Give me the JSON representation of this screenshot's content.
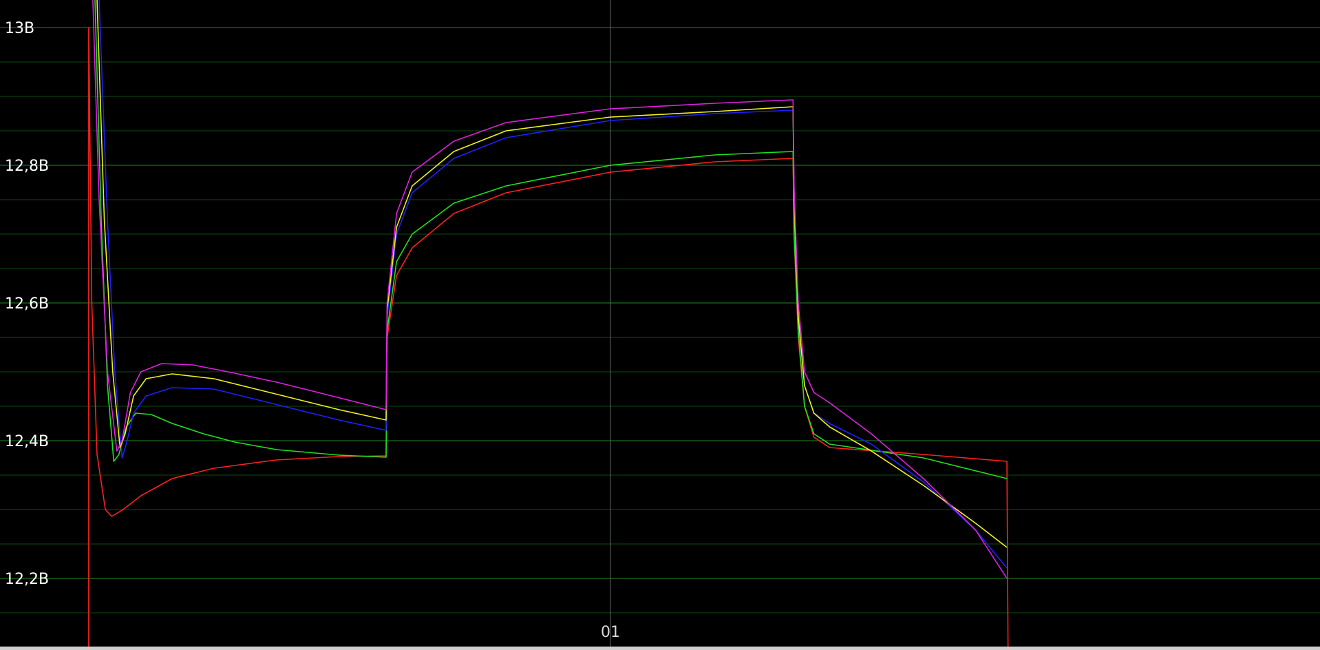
{
  "chart_data": {
    "type": "line",
    "background": "#000000",
    "grid": true,
    "grid_color": "#1f8a1f",
    "ylim": [
      12.1,
      13.04
    ],
    "y_major_ticks": [
      {
        "value": 13.0,
        "label": "13В"
      },
      {
        "value": 12.8,
        "label": "12,8В"
      },
      {
        "value": 12.6,
        "label": "12,6В"
      },
      {
        "value": 12.4,
        "label": "12,4В"
      },
      {
        "value": 12.2,
        "label": "12,2В"
      }
    ],
    "y_minor_ticks": [
      12.95,
      12.9,
      12.85,
      12.75,
      12.7,
      12.65,
      12.55,
      12.5,
      12.45,
      12.35,
      12.3,
      12.25,
      12.15
    ],
    "x_markers": [
      {
        "x": 50,
        "label": "01"
      }
    ],
    "x_range": [
      -8.5,
      118
    ],
    "series": [
      {
        "color": "#ff2020",
        "points": [
          [
            0,
            12.1
          ],
          [
            0,
            13.0
          ],
          [
            0.3,
            12.6
          ],
          [
            0.8,
            12.38
          ],
          [
            1.6,
            12.3
          ],
          [
            2.2,
            12.29
          ],
          [
            3.3,
            12.3
          ],
          [
            5,
            12.32
          ],
          [
            8,
            12.345
          ],
          [
            12,
            12.36
          ],
          [
            18,
            12.372
          ],
          [
            24,
            12.377
          ],
          [
            28.5,
            12.378
          ],
          [
            28.6,
            12.55
          ],
          [
            29.5,
            12.64
          ],
          [
            31,
            12.68
          ],
          [
            35,
            12.73
          ],
          [
            40,
            12.76
          ],
          [
            50,
            12.79
          ],
          [
            60,
            12.805
          ],
          [
            67.5,
            12.81
          ],
          [
            67.6,
            12.7
          ],
          [
            68,
            12.55
          ],
          [
            68.6,
            12.45
          ],
          [
            69.5,
            12.405
          ],
          [
            71,
            12.39
          ],
          [
            80,
            12.38
          ],
          [
            88,
            12.37
          ],
          [
            88.1,
            12.1
          ]
        ]
      },
      {
        "color": "#20e020",
        "points": [
          [
            0.6,
            13.04
          ],
          [
            1.2,
            12.72
          ],
          [
            1.8,
            12.48
          ],
          [
            2.4,
            12.37
          ],
          [
            2.9,
            12.38
          ],
          [
            3.6,
            12.42
          ],
          [
            4.5,
            12.44
          ],
          [
            6,
            12.438
          ],
          [
            8,
            12.425
          ],
          [
            11,
            12.41
          ],
          [
            14,
            12.398
          ],
          [
            18,
            12.387
          ],
          [
            24,
            12.379
          ],
          [
            28.5,
            12.376
          ],
          [
            28.6,
            12.56
          ],
          [
            29.5,
            12.66
          ],
          [
            31,
            12.7
          ],
          [
            35,
            12.745
          ],
          [
            40,
            12.77
          ],
          [
            50,
            12.8
          ],
          [
            60,
            12.815
          ],
          [
            67.5,
            12.82
          ],
          [
            67.6,
            12.7
          ],
          [
            68,
            12.56
          ],
          [
            68.6,
            12.45
          ],
          [
            69.5,
            12.41
          ],
          [
            71,
            12.395
          ],
          [
            80,
            12.375
          ],
          [
            88,
            12.345
          ]
        ]
      },
      {
        "color": "#2020ff",
        "points": [
          [
            1.0,
            13.04
          ],
          [
            1.8,
            12.72
          ],
          [
            2.5,
            12.5
          ],
          [
            3.2,
            12.375
          ],
          [
            3.6,
            12.395
          ],
          [
            4.3,
            12.44
          ],
          [
            5.5,
            12.465
          ],
          [
            8,
            12.477
          ],
          [
            12,
            12.475
          ],
          [
            16,
            12.46
          ],
          [
            20,
            12.445
          ],
          [
            24,
            12.43
          ],
          [
            28.5,
            12.415
          ],
          [
            28.6,
            12.58
          ],
          [
            29.5,
            12.7
          ],
          [
            31,
            12.76
          ],
          [
            35,
            12.81
          ],
          [
            40,
            12.84
          ],
          [
            50,
            12.865
          ],
          [
            60,
            12.875
          ],
          [
            67.5,
            12.88
          ],
          [
            67.6,
            12.75
          ],
          [
            68,
            12.58
          ],
          [
            68.6,
            12.48
          ],
          [
            69.5,
            12.44
          ],
          [
            71,
            12.425
          ],
          [
            75,
            12.395
          ],
          [
            80,
            12.34
          ],
          [
            85,
            12.27
          ],
          [
            88,
            12.215
          ]
        ]
      },
      {
        "color": "#f0f020",
        "points": [
          [
            0.8,
            13.04
          ],
          [
            1.5,
            12.72
          ],
          [
            2.3,
            12.5
          ],
          [
            3.0,
            12.39
          ],
          [
            3.5,
            12.41
          ],
          [
            4.3,
            12.465
          ],
          [
            5.5,
            12.49
          ],
          [
            8,
            12.497
          ],
          [
            12,
            12.49
          ],
          [
            16,
            12.475
          ],
          [
            20,
            12.46
          ],
          [
            24,
            12.445
          ],
          [
            28.5,
            12.43
          ],
          [
            28.6,
            12.59
          ],
          [
            29.5,
            12.71
          ],
          [
            31,
            12.77
          ],
          [
            35,
            12.82
          ],
          [
            40,
            12.85
          ],
          [
            50,
            12.87
          ],
          [
            60,
            12.878
          ],
          [
            67.5,
            12.885
          ],
          [
            67.6,
            12.75
          ],
          [
            68,
            12.58
          ],
          [
            68.6,
            12.48
          ],
          [
            69.5,
            12.44
          ],
          [
            71,
            12.42
          ],
          [
            75,
            12.385
          ],
          [
            80,
            12.335
          ],
          [
            85,
            12.28
          ],
          [
            88,
            12.245
          ]
        ]
      },
      {
        "color": "#e020e0",
        "points": [
          [
            0.4,
            13.04
          ],
          [
            1.0,
            12.75
          ],
          [
            1.8,
            12.5
          ],
          [
            2.7,
            12.385
          ],
          [
            3.2,
            12.4
          ],
          [
            4.0,
            12.47
          ],
          [
            5,
            12.5
          ],
          [
            7,
            12.512
          ],
          [
            10,
            12.51
          ],
          [
            14,
            12.498
          ],
          [
            18,
            12.485
          ],
          [
            22,
            12.47
          ],
          [
            28.5,
            12.445
          ],
          [
            28.6,
            12.6
          ],
          [
            29.5,
            12.73
          ],
          [
            31,
            12.79
          ],
          [
            35,
            12.835
          ],
          [
            40,
            12.862
          ],
          [
            50,
            12.882
          ],
          [
            60,
            12.89
          ],
          [
            67.5,
            12.895
          ],
          [
            67.6,
            12.77
          ],
          [
            68,
            12.6
          ],
          [
            68.6,
            12.5
          ],
          [
            69.5,
            12.47
          ],
          [
            71,
            12.455
          ],
          [
            75,
            12.41
          ],
          [
            80,
            12.345
          ],
          [
            85,
            12.27
          ],
          [
            88,
            12.2
          ]
        ]
      }
    ]
  }
}
